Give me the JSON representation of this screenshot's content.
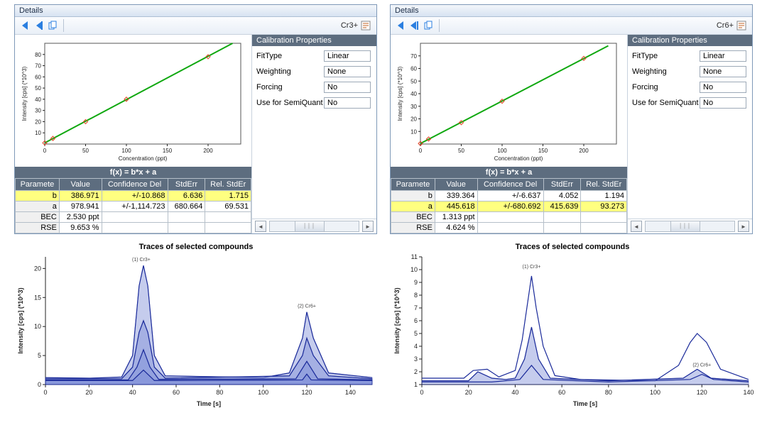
{
  "panels": [
    {
      "title": "Details",
      "toolbarLabel": "Cr3+",
      "eq": "f(x) = b*x + a",
      "calProps": {
        "title": "Calibration Properties",
        "fitTypeLabel": "FitType",
        "fitType": "Linear",
        "weightingLabel": "Weighting",
        "weighting": "None",
        "forcingLabel": "Forcing",
        "forcing": "No",
        "semiLabel": "Use for SemiQuant",
        "semi": "No"
      },
      "tableHeaders": [
        "Paramete",
        "Value",
        "Confidence Del",
        "StdErr",
        "Rel. StdEr"
      ],
      "highlightRow": "b",
      "rows": [
        {
          "p": "b",
          "v": "386.971",
          "c": "+/-10.868",
          "s": "6.636",
          "r": "1.715"
        },
        {
          "p": "a",
          "v": "978.941",
          "c": "+/-1,114.723",
          "s": "680.664",
          "r": "69.531"
        },
        {
          "p": "BEC",
          "v": "2.530 ppt",
          "c": "",
          "s": "",
          "r": ""
        },
        {
          "p": "RSE",
          "v": "9.653 %",
          "c": "",
          "s": "",
          "r": ""
        }
      ]
    },
    {
      "title": "Details",
      "toolbarLabel": "Cr6+",
      "eq": "f(x) = b*x + a",
      "calProps": {
        "title": "Calibration Properties",
        "fitTypeLabel": "FitType",
        "fitType": "Linear",
        "weightingLabel": "Weighting",
        "weighting": "None",
        "forcingLabel": "Forcing",
        "forcing": "No",
        "semiLabel": "Use for SemiQuant",
        "semi": "No"
      },
      "tableHeaders": [
        "Paramete",
        "Value",
        "Confidence Del",
        "StdErr",
        "Rel. StdEr"
      ],
      "highlightRow": "a",
      "rows": [
        {
          "p": "b",
          "v": "339.364",
          "c": "+/-6.637",
          "s": "4.052",
          "r": "1.194"
        },
        {
          "p": "a",
          "v": "445.618",
          "c": "+/-680.692",
          "s": "415.639",
          "r": "93.273"
        },
        {
          "p": "BEC",
          "v": "1.313 ppt",
          "c": "",
          "s": "",
          "r": ""
        },
        {
          "p": "RSE",
          "v": "4.624 %",
          "c": "",
          "s": "",
          "r": ""
        }
      ]
    }
  ],
  "traces": [
    {
      "title": "Traces of selected compounds",
      "xlabel": "Time [s]",
      "ylabel": "Intensit; [cps] (*10^3)"
    },
    {
      "title": "Traces of selected compounds",
      "xlabel": "Time [s]",
      "ylabel": "Intensit; [cps] (*10^3)"
    }
  ],
  "chart_data": [
    {
      "type": "scatter_line",
      "title": "Calibration Cr3+",
      "xlabel": "Concentration (ppt)",
      "ylabel": "Intensity [cps] (*10^3)",
      "xlim": [
        0,
        240
      ],
      "ylim": [
        0,
        90
      ],
      "xticks": [
        0,
        50,
        100,
        150,
        200
      ],
      "yticks": [
        10,
        20,
        30,
        40,
        50,
        60,
        70,
        80
      ],
      "series": [
        {
          "name": "fit",
          "type": "line",
          "points": [
            [
              0,
              1.0
            ],
            [
              230,
              90
            ]
          ]
        },
        {
          "name": "points",
          "type": "scatter",
          "points": [
            [
              0,
              1
            ],
            [
              10,
              5
            ],
            [
              50,
              20
            ],
            [
              100,
              40
            ],
            [
              200,
              78
            ]
          ]
        }
      ]
    },
    {
      "type": "scatter_line",
      "title": "Calibration Cr6+",
      "xlabel": "Concentration (ppt)",
      "ylabel": "Intensity [cps] (*10^3)",
      "xlim": [
        0,
        240
      ],
      "ylim": [
        0,
        80
      ],
      "xticks": [
        0,
        50,
        100,
        150,
        200
      ],
      "yticks": [
        10,
        20,
        30,
        40,
        50,
        60,
        70
      ],
      "series": [
        {
          "name": "fit",
          "type": "line",
          "points": [
            [
              0,
              0.4
            ],
            [
              230,
              78
            ]
          ]
        },
        {
          "name": "points",
          "type": "scatter",
          "points": [
            [
              0,
              0.4
            ],
            [
              10,
              4
            ],
            [
              50,
              17
            ],
            [
              100,
              34
            ],
            [
              200,
              68
            ]
          ]
        }
      ]
    },
    {
      "type": "line",
      "title": "Traces of selected compounds",
      "xlabel": "Time [s]",
      "ylabel": "Intensity [cps] (*10^3)",
      "xlim": [
        0,
        150
      ],
      "ylim": [
        0,
        22
      ],
      "xticks": [
        0,
        20,
        40,
        60,
        80,
        100,
        120,
        140
      ],
      "yticks": [
        0,
        5,
        10,
        15,
        20
      ],
      "annotations": [
        {
          "x": 44,
          "y": 21,
          "text": "(1) Cr3+"
        },
        {
          "x": 120,
          "y": 13,
          "text": "(2) Cr6+"
        }
      ],
      "series": [
        {
          "name": "s1",
          "values": [
            [
              0,
              1.2
            ],
            [
              20,
              1.1
            ],
            [
              35,
              1.3
            ],
            [
              40,
              5
            ],
            [
              43,
              17
            ],
            [
              45,
              20.5
            ],
            [
              47,
              17
            ],
            [
              50,
              5
            ],
            [
              55,
              1.5
            ],
            [
              100,
              1.2
            ],
            [
              112,
              2
            ],
            [
              118,
              8
            ],
            [
              120,
              12.5
            ],
            [
              123,
              8
            ],
            [
              130,
              2
            ],
            [
              150,
              1.2
            ]
          ],
          "area": true
        },
        {
          "name": "s2",
          "values": [
            [
              0,
              1.0
            ],
            [
              35,
              1.0
            ],
            [
              40,
              3
            ],
            [
              43,
              9
            ],
            [
              45,
              11
            ],
            [
              47,
              9
            ],
            [
              50,
              3
            ],
            [
              55,
              1.1
            ],
            [
              112,
              1.5
            ],
            [
              118,
              5
            ],
            [
              120,
              8
            ],
            [
              123,
              5
            ],
            [
              130,
              1.5
            ],
            [
              150,
              1.0
            ]
          ],
          "area": true
        },
        {
          "name": "s3",
          "values": [
            [
              0,
              0.8
            ],
            [
              38,
              0.8
            ],
            [
              42,
              3
            ],
            [
              45,
              6
            ],
            [
              48,
              3
            ],
            [
              52,
              0.9
            ],
            [
              115,
              1
            ],
            [
              120,
              4
            ],
            [
              125,
              1
            ],
            [
              150,
              0.8
            ]
          ],
          "area": true
        },
        {
          "name": "s4",
          "values": [
            [
              0,
              0.7
            ],
            [
              40,
              0.7
            ],
            [
              45,
              2.5
            ],
            [
              50,
              0.7
            ],
            [
              118,
              0.8
            ],
            [
              120,
              1.8
            ],
            [
              122,
              0.8
            ],
            [
              150,
              0.7
            ]
          ],
          "area": true
        }
      ]
    },
    {
      "type": "line",
      "title": "Traces of selected compounds",
      "xlabel": "Time [s]",
      "ylabel": "Intensity [cps] (*10^3)",
      "xlim": [
        0,
        140
      ],
      "ylim": [
        1,
        11
      ],
      "xticks": [
        0,
        20,
        40,
        60,
        80,
        100,
        120,
        140
      ],
      "yticks": [
        1,
        2,
        3,
        4,
        5,
        6,
        7,
        8,
        9,
        10,
        11
      ],
      "annotations": [
        {
          "x": 47,
          "y": 10,
          "text": "(1) Cr3+"
        },
        {
          "x": 120,
          "y": 2.3,
          "text": "(2) Cr6+"
        }
      ],
      "series": [
        {
          "name": "s4",
          "values": [
            [
              0,
              1.5
            ],
            [
              18,
              1.5
            ],
            [
              22,
              2.1
            ],
            [
              28,
              2.2
            ],
            [
              33,
              1.6
            ],
            [
              40,
              2.1
            ],
            [
              43,
              4.5
            ],
            [
              45,
              7
            ],
            [
              47,
              9.5
            ],
            [
              49,
              7
            ],
            [
              52,
              4
            ],
            [
              57,
              1.7
            ],
            [
              68,
              1.4
            ],
            [
              100,
              1.3
            ],
            [
              110,
              2.5
            ],
            [
              115,
              4.3
            ],
            [
              118,
              5
            ],
            [
              122,
              4.3
            ],
            [
              128,
              2.2
            ],
            [
              140,
              1.4
            ]
          ],
          "area": false
        },
        {
          "name": "s5",
          "values": [
            [
              0,
              1.3
            ],
            [
              20,
              1.3
            ],
            [
              24,
              2.0
            ],
            [
              30,
              1.5
            ],
            [
              36,
              1.4
            ],
            [
              40,
              1.5
            ],
            [
              44,
              3
            ],
            [
              47,
              5.5
            ],
            [
              50,
              3
            ],
            [
              55,
              1.5
            ],
            [
              80,
              1.3
            ],
            [
              112,
              1.5
            ],
            [
              118,
              2.2
            ],
            [
              124,
              1.5
            ],
            [
              140,
              1.3
            ]
          ],
          "area": true
        },
        {
          "name": "s6",
          "values": [
            [
              0,
              1.2
            ],
            [
              30,
              1.2
            ],
            [
              42,
              1.4
            ],
            [
              47,
              2.5
            ],
            [
              52,
              1.4
            ],
            [
              80,
              1.2
            ],
            [
              115,
              1.4
            ],
            [
              120,
              1.8
            ],
            [
              125,
              1.4
            ],
            [
              140,
              1.2
            ]
          ],
          "area": false
        }
      ]
    }
  ]
}
